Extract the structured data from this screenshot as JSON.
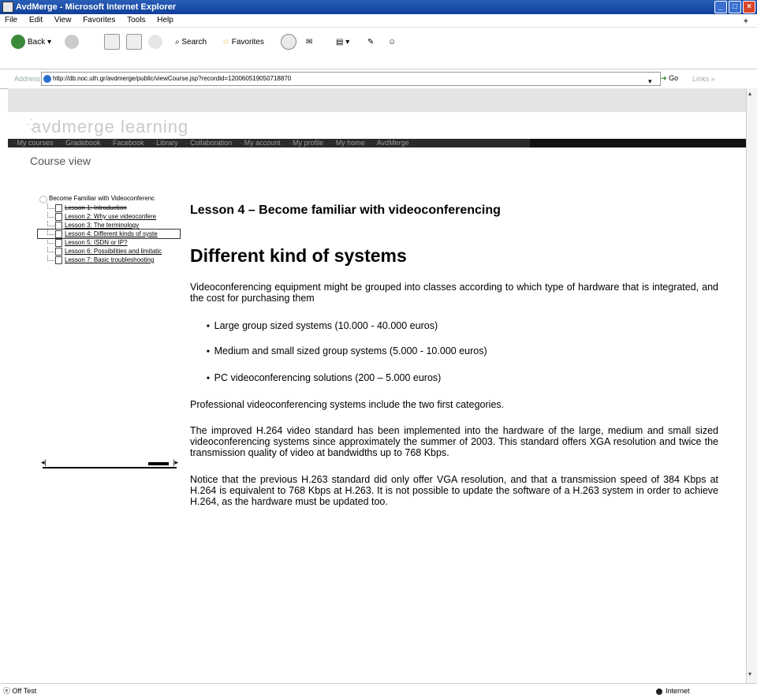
{
  "window": {
    "title": "AvdMerge - Microsoft Internet Explorer"
  },
  "menubar": {
    "items": [
      "File",
      "Edit",
      "View",
      "Favorites",
      "Tools",
      "Help"
    ]
  },
  "toolbar": {
    "back_label": "Back",
    "search_label": "Search",
    "favorites_label": "Favorites"
  },
  "addressbar": {
    "label": "Address",
    "url": "http://db.noc.uth.gr/avdmerge/public/viewCourse.jsp?recordid=120060519050718870",
    "go_label": "Go",
    "links_label": "Links"
  },
  "site": {
    "logo": "avdmerge learning",
    "nav": [
      "My courses",
      "Gradebook",
      "Facebook",
      "Library",
      "Collaboration",
      "My account",
      "My profile",
      "My home",
      "AvdMerge"
    ],
    "page_title": "Course view"
  },
  "tree": {
    "root": "Become Familiar with Videoconferenc",
    "items": [
      "Lesson 1: Introduction",
      "Lesson 2: Why use videoconfere",
      "Lesson 3: The terminology",
      "Lesson 4: Different kinds of syste",
      "Lesson 5: ISDN or IP?",
      "Lesson 6: Possibilities and limitatic",
      "Lesson 7: Basic troubleshooting"
    ]
  },
  "lesson": {
    "title": "Lesson 4 – Become familiar with videoconferencing",
    "heading": "Different kind of systems",
    "intro": "Videoconferencing equipment might be grouped into classes according to which type of hardware that is integrated, and the cost for purchasing them",
    "bullets": [
      "Large group sized systems (10.000 - 40.000 euros)",
      "Medium and small sized group systems (5.000 - 10.000 euros)",
      "PC videoconferencing solutions (200 – 5.000 euros)"
    ],
    "p2": "Professional videoconferencing systems include the two first categories.",
    "p3": "The improved H.264 video standard has been implemented into the hardware of the large, medium and small sized videoconferencing systems since approximately the summer of 2003. This standard offers XGA resolution and twice the transmission quality of video at bandwidths up to 768 Kbps.",
    "p4": "Notice that the previous H.263 standard did only offer VGA resolution, and that a transmission speed of 384 Kbps at H.264 is equivalent to 768 Kbps at H.263. It is not possible to update the software of a H.263 system in order to achieve H.264, as the hardware must be updated too."
  },
  "statusbar": {
    "left": "Off Test",
    "zone": "Internet"
  }
}
